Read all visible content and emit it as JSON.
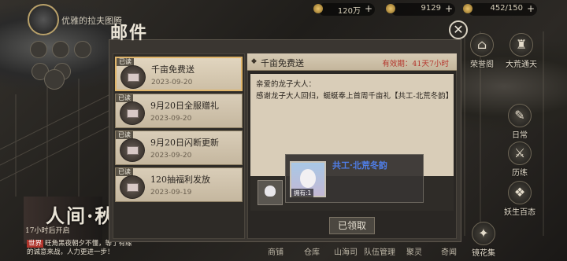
{
  "top": {
    "player_title": "优雅的拉夫图腾",
    "res1": "120万",
    "res2": "9129",
    "res3": "452/150"
  },
  "left": {
    "news_big": "人间·秋",
    "news_time": "17小时后开启",
    "chat_tag": "世界",
    "chat_text": "旺角黑夜朝夕不懂，等了有缘的诚意来战，人力更进一步！"
  },
  "right_menu": [
    {
      "label": "荣誉阁",
      "icon": "hall-icon"
    },
    {
      "label": "大荒通天",
      "icon": "tower-icon"
    },
    {
      "label": "日常",
      "icon": "daily-icon"
    },
    {
      "label": "历练",
      "icon": "sword-icon"
    },
    {
      "label": "妖生百态",
      "icon": "cards-icon"
    },
    {
      "label": "镜花集",
      "icon": "mirror-icon"
    }
  ],
  "bottom_nav": [
    "商铺",
    "仓库",
    "山海司",
    "队伍管理",
    "聚灵",
    "奇闻"
  ],
  "mail": {
    "title": "邮件",
    "items": [
      {
        "badge": "已读",
        "title": "千亩免费送",
        "date": "2023-09-20",
        "selected": true
      },
      {
        "badge": "已读",
        "title": "9月20日全服赠礼",
        "date": "2023-09-20",
        "selected": false
      },
      {
        "badge": "已读",
        "title": "9月20日闪断更新",
        "date": "2023-09-20",
        "selected": false
      },
      {
        "badge": "已读",
        "title": "120抽福利发放",
        "date": "2023-09-19",
        "selected": false
      }
    ],
    "detail": {
      "title": "千亩免费送",
      "expire": "有效期：41天7小时",
      "greeting": "亲爱的龙子大人：",
      "body": "感谢龙子大人回归，蜒蜒奉上首周千亩礼【共工-北荒冬韵】"
    },
    "claim_label": "已领取"
  },
  "tooltip": {
    "name": "共工·北荒冬韵",
    "owned": "拥有:1"
  }
}
